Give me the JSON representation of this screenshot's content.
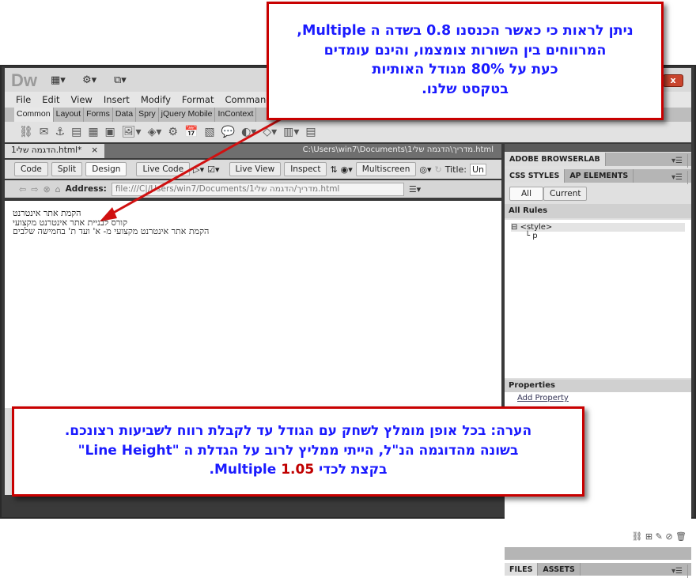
{
  "app": {
    "logo": "Dw",
    "close": "x"
  },
  "menu": [
    "File",
    "Edit",
    "View",
    "Insert",
    "Modify",
    "Format",
    "Commands"
  ],
  "insert_tabs": [
    "Common",
    "Layout",
    "Forms",
    "Data",
    "Spry",
    "jQuery Mobile",
    "InContext"
  ],
  "document": {
    "tab_label": "הדגמה שלי1.html*",
    "tab_close": "×",
    "path": "C:\\Users\\win7\\Documents\\1מדריך\\הדגמה שלי.html",
    "view_buttons": [
      "Code",
      "Split",
      "Design"
    ],
    "live_code": "Live Code",
    "live_view": "Live View",
    "inspect": "Inspect",
    "multiscreen": "Multiscreen",
    "title_label": "Title:",
    "title_value": "Un",
    "address_label": "Address:",
    "address_value": "file:///C|/Users/win7/Documents/1מדריך/הדגמה שלי.html",
    "lines": [
      "הקמת אתר אינטרנט",
      "קורס לבניית אתר אינטרנט מקצועי",
      "הקמת אתר אינטרנט מקצועי מ- א' ועד ת' בחמישה שלבים"
    ]
  },
  "panel": {
    "browserlab": "ADOBE BROWSERLAB",
    "tabs": [
      "CSS STYLES",
      "AP ELEMENTS"
    ],
    "modes": [
      "All",
      "Current"
    ],
    "all_rules": "All Rules",
    "tree": [
      "<style>",
      "p"
    ],
    "properties": "Properties",
    "add_property": "Add Property",
    "bottom_tabs": [
      "FILES",
      "ASSETS"
    ]
  },
  "callouts": {
    "top": [
      "ניתן לראות כי כאשר הכנסנו 0.8 בשדה ה Multiple,",
      "המרווחים בין השורות צומצמו, והינם עומדים",
      "כעת על 80% מגודל האותיות",
      "בטקסט שלנו."
    ],
    "bottom": {
      "line1": "הערה: בכל אופן מומלץ לשחק עם הגודל עד לקבלת רווח לשביעות רצונכם.",
      "line2": "בשונה מהדוגמה הנ\"ל, הייתי ממליץ לרוב על הגדלת ה \"Line Height\"",
      "line3_pre": "בקצת לכדי ",
      "line3_value": "1.05",
      "line3_post": " Multiple."
    }
  },
  "colors": {
    "callout_border": "#c80000",
    "callout_text": "#1a1aff",
    "highlight": "#c00000",
    "arrow": "#d01010"
  }
}
